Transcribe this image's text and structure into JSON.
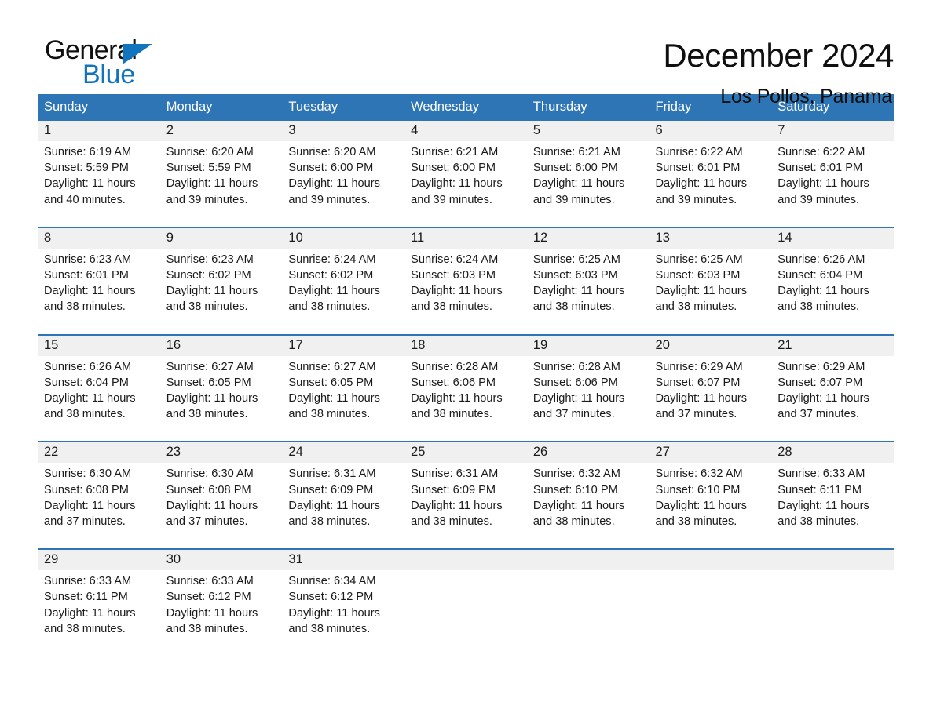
{
  "brand": {
    "name_top": "General",
    "name_bottom": "Blue",
    "triangle_color": "#1274bd",
    "icon": "triangle-icon"
  },
  "header": {
    "title": "December 2024",
    "location": "Los Pollos, Panama"
  },
  "theme": {
    "header_blue": "#2e75b6",
    "daynum_gray": "#f0f0f0",
    "text": "#1a1a1a"
  },
  "weekday_headers": [
    "Sunday",
    "Monday",
    "Tuesday",
    "Wednesday",
    "Thursday",
    "Friday",
    "Saturday"
  ],
  "weeks": [
    {
      "days": [
        {
          "num": "1",
          "sunrise": "Sunrise: 6:19 AM",
          "sunset": "Sunset: 5:59 PM",
          "daylight1": "Daylight: 11 hours",
          "daylight2": "and 40 minutes."
        },
        {
          "num": "2",
          "sunrise": "Sunrise: 6:20 AM",
          "sunset": "Sunset: 5:59 PM",
          "daylight1": "Daylight: 11 hours",
          "daylight2": "and 39 minutes."
        },
        {
          "num": "3",
          "sunrise": "Sunrise: 6:20 AM",
          "sunset": "Sunset: 6:00 PM",
          "daylight1": "Daylight: 11 hours",
          "daylight2": "and 39 minutes."
        },
        {
          "num": "4",
          "sunrise": "Sunrise: 6:21 AM",
          "sunset": "Sunset: 6:00 PM",
          "daylight1": "Daylight: 11 hours",
          "daylight2": "and 39 minutes."
        },
        {
          "num": "5",
          "sunrise": "Sunrise: 6:21 AM",
          "sunset": "Sunset: 6:00 PM",
          "daylight1": "Daylight: 11 hours",
          "daylight2": "and 39 minutes."
        },
        {
          "num": "6",
          "sunrise": "Sunrise: 6:22 AM",
          "sunset": "Sunset: 6:01 PM",
          "daylight1": "Daylight: 11 hours",
          "daylight2": "and 39 minutes."
        },
        {
          "num": "7",
          "sunrise": "Sunrise: 6:22 AM",
          "sunset": "Sunset: 6:01 PM",
          "daylight1": "Daylight: 11 hours",
          "daylight2": "and 39 minutes."
        }
      ]
    },
    {
      "days": [
        {
          "num": "8",
          "sunrise": "Sunrise: 6:23 AM",
          "sunset": "Sunset: 6:01 PM",
          "daylight1": "Daylight: 11 hours",
          "daylight2": "and 38 minutes."
        },
        {
          "num": "9",
          "sunrise": "Sunrise: 6:23 AM",
          "sunset": "Sunset: 6:02 PM",
          "daylight1": "Daylight: 11 hours",
          "daylight2": "and 38 minutes."
        },
        {
          "num": "10",
          "sunrise": "Sunrise: 6:24 AM",
          "sunset": "Sunset: 6:02 PM",
          "daylight1": "Daylight: 11 hours",
          "daylight2": "and 38 minutes."
        },
        {
          "num": "11",
          "sunrise": "Sunrise: 6:24 AM",
          "sunset": "Sunset: 6:03 PM",
          "daylight1": "Daylight: 11 hours",
          "daylight2": "and 38 minutes."
        },
        {
          "num": "12",
          "sunrise": "Sunrise: 6:25 AM",
          "sunset": "Sunset: 6:03 PM",
          "daylight1": "Daylight: 11 hours",
          "daylight2": "and 38 minutes."
        },
        {
          "num": "13",
          "sunrise": "Sunrise: 6:25 AM",
          "sunset": "Sunset: 6:03 PM",
          "daylight1": "Daylight: 11 hours",
          "daylight2": "and 38 minutes."
        },
        {
          "num": "14",
          "sunrise": "Sunrise: 6:26 AM",
          "sunset": "Sunset: 6:04 PM",
          "daylight1": "Daylight: 11 hours",
          "daylight2": "and 38 minutes."
        }
      ]
    },
    {
      "days": [
        {
          "num": "15",
          "sunrise": "Sunrise: 6:26 AM",
          "sunset": "Sunset: 6:04 PM",
          "daylight1": "Daylight: 11 hours",
          "daylight2": "and 38 minutes."
        },
        {
          "num": "16",
          "sunrise": "Sunrise: 6:27 AM",
          "sunset": "Sunset: 6:05 PM",
          "daylight1": "Daylight: 11 hours",
          "daylight2": "and 38 minutes."
        },
        {
          "num": "17",
          "sunrise": "Sunrise: 6:27 AM",
          "sunset": "Sunset: 6:05 PM",
          "daylight1": "Daylight: 11 hours",
          "daylight2": "and 38 minutes."
        },
        {
          "num": "18",
          "sunrise": "Sunrise: 6:28 AM",
          "sunset": "Sunset: 6:06 PM",
          "daylight1": "Daylight: 11 hours",
          "daylight2": "and 38 minutes."
        },
        {
          "num": "19",
          "sunrise": "Sunrise: 6:28 AM",
          "sunset": "Sunset: 6:06 PM",
          "daylight1": "Daylight: 11 hours",
          "daylight2": "and 37 minutes."
        },
        {
          "num": "20",
          "sunrise": "Sunrise: 6:29 AM",
          "sunset": "Sunset: 6:07 PM",
          "daylight1": "Daylight: 11 hours",
          "daylight2": "and 37 minutes."
        },
        {
          "num": "21",
          "sunrise": "Sunrise: 6:29 AM",
          "sunset": "Sunset: 6:07 PM",
          "daylight1": "Daylight: 11 hours",
          "daylight2": "and 37 minutes."
        }
      ]
    },
    {
      "days": [
        {
          "num": "22",
          "sunrise": "Sunrise: 6:30 AM",
          "sunset": "Sunset: 6:08 PM",
          "daylight1": "Daylight: 11 hours",
          "daylight2": "and 37 minutes."
        },
        {
          "num": "23",
          "sunrise": "Sunrise: 6:30 AM",
          "sunset": "Sunset: 6:08 PM",
          "daylight1": "Daylight: 11 hours",
          "daylight2": "and 37 minutes."
        },
        {
          "num": "24",
          "sunrise": "Sunrise: 6:31 AM",
          "sunset": "Sunset: 6:09 PM",
          "daylight1": "Daylight: 11 hours",
          "daylight2": "and 38 minutes."
        },
        {
          "num": "25",
          "sunrise": "Sunrise: 6:31 AM",
          "sunset": "Sunset: 6:09 PM",
          "daylight1": "Daylight: 11 hours",
          "daylight2": "and 38 minutes."
        },
        {
          "num": "26",
          "sunrise": "Sunrise: 6:32 AM",
          "sunset": "Sunset: 6:10 PM",
          "daylight1": "Daylight: 11 hours",
          "daylight2": "and 38 minutes."
        },
        {
          "num": "27",
          "sunrise": "Sunrise: 6:32 AM",
          "sunset": "Sunset: 6:10 PM",
          "daylight1": "Daylight: 11 hours",
          "daylight2": "and 38 minutes."
        },
        {
          "num": "28",
          "sunrise": "Sunrise: 6:33 AM",
          "sunset": "Sunset: 6:11 PM",
          "daylight1": "Daylight: 11 hours",
          "daylight2": "and 38 minutes."
        }
      ]
    },
    {
      "days": [
        {
          "num": "29",
          "sunrise": "Sunrise: 6:33 AM",
          "sunset": "Sunset: 6:11 PM",
          "daylight1": "Daylight: 11 hours",
          "daylight2": "and 38 minutes."
        },
        {
          "num": "30",
          "sunrise": "Sunrise: 6:33 AM",
          "sunset": "Sunset: 6:12 PM",
          "daylight1": "Daylight: 11 hours",
          "daylight2": "and 38 minutes."
        },
        {
          "num": "31",
          "sunrise": "Sunrise: 6:34 AM",
          "sunset": "Sunset: 6:12 PM",
          "daylight1": "Daylight: 11 hours",
          "daylight2": "and 38 minutes."
        },
        {
          "num": "",
          "sunrise": "",
          "sunset": "",
          "daylight1": "",
          "daylight2": ""
        },
        {
          "num": "",
          "sunrise": "",
          "sunset": "",
          "daylight1": "",
          "daylight2": ""
        },
        {
          "num": "",
          "sunrise": "",
          "sunset": "",
          "daylight1": "",
          "daylight2": ""
        },
        {
          "num": "",
          "sunrise": "",
          "sunset": "",
          "daylight1": "",
          "daylight2": ""
        }
      ]
    }
  ]
}
